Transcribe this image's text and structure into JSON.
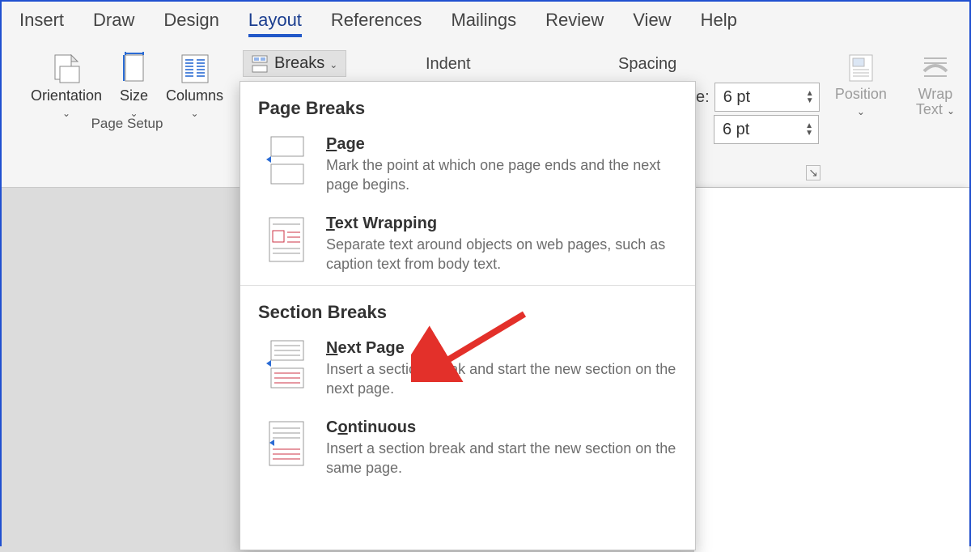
{
  "tabs": {
    "insert": "Insert",
    "draw": "Draw",
    "design": "Design",
    "layout": "Layout",
    "references": "References",
    "mailings": "Mailings",
    "review": "Review",
    "view": "View",
    "help": "Help"
  },
  "page_setup": {
    "orientation": "Orientation",
    "size": "Size",
    "columns": "Columns",
    "group_label": "Page Setup",
    "breaks": "Breaks"
  },
  "paragraph": {
    "indent": "Indent",
    "spacing": "Spacing",
    "truncated": "e:",
    "before": "6 pt",
    "after": "6 pt"
  },
  "arrange": {
    "position": "Position",
    "wrap": "Wrap",
    "wrap2": "Text"
  },
  "dropdown": {
    "sec1": "Page Breaks",
    "sec2": "Section Breaks",
    "items": [
      {
        "title": "Page",
        "desc": "Mark the point at which one page ends and the next page begins."
      },
      {
        "title": "Text Wrapping",
        "desc": "Separate text around objects on web pages, such as caption text from body text."
      },
      {
        "title": "Next Page",
        "desc": "Insert a section break and start the new section on the next page."
      },
      {
        "title": "Continuous",
        "desc": "Insert a section break and start the new section on the same page."
      }
    ]
  }
}
